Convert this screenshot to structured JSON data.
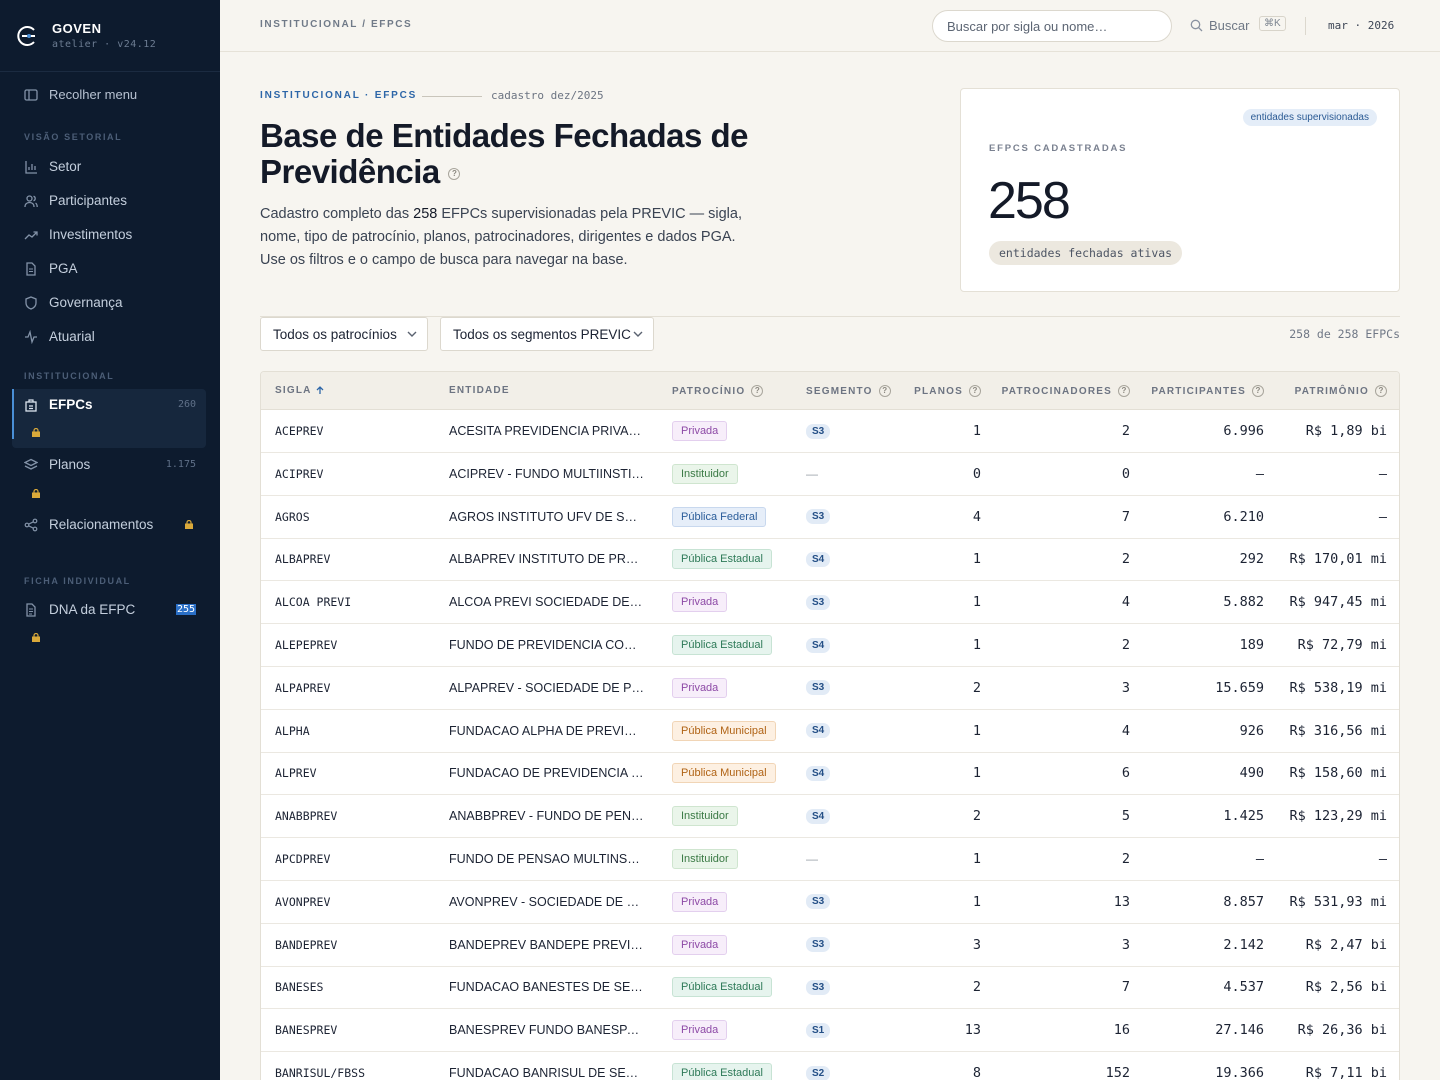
{
  "brand": {
    "name": "GOVEN",
    "version": "atelier · v24.12"
  },
  "sidebar": {
    "collapse_label": "Recolher menu",
    "section_setorial": "VISÃO SETORIAL",
    "setorial_items": [
      {
        "label": "Setor",
        "icon": "bar-chart-icon"
      },
      {
        "label": "Participantes",
        "icon": "users-icon"
      },
      {
        "label": "Investimentos",
        "icon": "trending-up-icon"
      },
      {
        "label": "PGA",
        "icon": "document-icon"
      },
      {
        "label": "Governança",
        "icon": "shield-icon"
      },
      {
        "label": "Atuarial",
        "icon": "pulse-icon"
      }
    ],
    "section_institucional": "INSTITUCIONAL",
    "inst_items": [
      {
        "label": "EFPCs",
        "count": "260",
        "icon": "building-icon"
      },
      {
        "label": "Planos",
        "count": "1.175",
        "icon": "layers-icon"
      },
      {
        "label": "Relacionamentos",
        "icon": "share-icon"
      }
    ],
    "section_ficha": "FICHA INDIVIDUAL",
    "ficha_items": [
      {
        "label": "DNA da EFPC",
        "count": "255",
        "icon": "file-icon"
      }
    ]
  },
  "topbar": {
    "breadcrumb": "INSTITUCIONAL / EFPCS",
    "search_placeholder": "Buscar por sigla ou nome…",
    "search_label": "Buscar",
    "shortcut": "⌘K",
    "period": "mar · 2026"
  },
  "hero": {
    "eyebrow": "INSTITUCIONAL · EFPCS",
    "cadastro": "cadastro dez/2025",
    "title": "Base de Entidades Fechadas de Previdência",
    "desc_pre": "Cadastro completo das ",
    "desc_num": "258",
    "desc_post": " EFPCs supervisionadas pela PREVIC — sigla, nome, tipo de patrocínio, planos, patrocinadores, dirigentes e dados PGA. Use os filtros e o campo de busca para navegar na base."
  },
  "kpi": {
    "tag": "entidades supervisionadas",
    "label": "EFPCS CADASTRADAS",
    "value": "258",
    "pill": "entidades fechadas ativas"
  },
  "filters": {
    "patrocinio": "Todos os patrocínios",
    "segmento": "Todos os segmentos PREVIC",
    "count": "258 de 258 EFPCs"
  },
  "table": {
    "headers": {
      "sigla": "SIGLA",
      "entidade": "ENTIDADE",
      "patrocinio": "PATROCÍNIO",
      "segmento": "SEGMENTO",
      "planos": "PLANOS",
      "patrocinadores": "PATROCINADORES",
      "participantes": "PARTICIPANTES",
      "patrimonio": "PATRIMÔNIO"
    },
    "rows": [
      {
        "sigla": "ACEPREV",
        "entidade": "ACESITA PREVIDENCIA PRIVADA",
        "patrocinio": "Privada",
        "pcls": "privada",
        "segmento": "S3",
        "planos": "1",
        "patrocinadores": "2",
        "participantes": "6.996",
        "patrimonio": "R$ 1,89 bi"
      },
      {
        "sigla": "ACIPREV",
        "entidade": "ACIPREV - FUNDO MULTIINSTITUIDOR",
        "patrocinio": "Instituidor",
        "pcls": "instituidor",
        "segmento": "—",
        "planos": "0",
        "patrocinadores": "0",
        "participantes": "—",
        "patrimonio": "—"
      },
      {
        "sigla": "AGROS",
        "entidade": "AGROS INSTITUTO UFV DE SEGURIDADE SOCIAL",
        "patrocinio": "Pública Federal",
        "pcls": "federal",
        "segmento": "S3",
        "planos": "4",
        "patrocinadores": "7",
        "participantes": "6.210",
        "patrimonio": "—"
      },
      {
        "sigla": "ALBAPREV",
        "entidade": "ALBAPREV INSTITUTO DE PREVIDENCIA",
        "patrocinio": "Pública Estadual",
        "pcls": "estadual",
        "segmento": "S4",
        "planos": "1",
        "patrocinadores": "2",
        "participantes": "292",
        "patrimonio": "R$ 170,01 mi"
      },
      {
        "sigla": "ALCOA PREVI",
        "entidade": "ALCOA PREVI SOCIEDADE DE PREVIDENCIA",
        "patrocinio": "Privada",
        "pcls": "privada",
        "segmento": "S3",
        "planos": "1",
        "patrocinadores": "4",
        "participantes": "5.882",
        "patrimonio": "R$ 947,45 mi"
      },
      {
        "sigla": "ALEPEPREV",
        "entidade": "FUNDO DE PREVIDENCIA COMPLEMENTAR",
        "patrocinio": "Pública Estadual",
        "pcls": "estadual",
        "segmento": "S4",
        "planos": "1",
        "patrocinadores": "2",
        "participantes": "189",
        "patrimonio": "R$ 72,79 mi"
      },
      {
        "sigla": "ALPAPREV",
        "entidade": "ALPAPREV - SOCIEDADE DE PREVIDENCIA",
        "patrocinio": "Privada",
        "pcls": "privada",
        "segmento": "S3",
        "planos": "2",
        "patrocinadores": "3",
        "participantes": "15.659",
        "patrimonio": "R$ 538,19 mi"
      },
      {
        "sigla": "ALPHA",
        "entidade": "FUNDACAO ALPHA DE PREVIDENCIA",
        "patrocinio": "Pública Municipal",
        "pcls": "municipal",
        "segmento": "S4",
        "planos": "1",
        "patrocinadores": "4",
        "participantes": "926",
        "patrimonio": "R$ 316,56 mi"
      },
      {
        "sigla": "ALPREV",
        "entidade": "FUNDACAO  DE PREVIDENCIA COMPLEMENTAR",
        "patrocinio": "Pública Municipal",
        "pcls": "municipal",
        "segmento": "S4",
        "planos": "1",
        "patrocinadores": "6",
        "participantes": "490",
        "patrimonio": "R$ 158,60 mi"
      },
      {
        "sigla": "ANABBPREV",
        "entidade": "ANABBPREV - FUNDO DE PENSAO",
        "patrocinio": "Instituidor",
        "pcls": "instituidor",
        "segmento": "S4",
        "planos": "2",
        "patrocinadores": "5",
        "participantes": "1.425",
        "patrimonio": "R$ 123,29 mi"
      },
      {
        "sigla": "APCDPREV",
        "entidade": "FUNDO DE PENSAO MULTINSTITUIDOR",
        "patrocinio": "Instituidor",
        "pcls": "instituidor",
        "segmento": "—",
        "planos": "1",
        "patrocinadores": "2",
        "participantes": "—",
        "patrimonio": "—"
      },
      {
        "sigla": "AVONPREV",
        "entidade": "AVONPREV - SOCIEDADE DE PREVIDENCIA",
        "patrocinio": "Privada",
        "pcls": "privada",
        "segmento": "S3",
        "planos": "1",
        "patrocinadores": "13",
        "participantes": "8.857",
        "patrimonio": "R$ 531,93 mi"
      },
      {
        "sigla": "BANDEPREV",
        "entidade": "BANDEPREV BANDEPE PREVIDENCIA SOCIAL",
        "patrocinio": "Privada",
        "pcls": "privada",
        "segmento": "S3",
        "planos": "3",
        "patrocinadores": "3",
        "participantes": "2.142",
        "patrimonio": "R$ 2,47 bi"
      },
      {
        "sigla": "BANESES",
        "entidade": "FUNDACAO BANESTES DE SEGURIDADE SOCIAL",
        "patrocinio": "Pública Estadual",
        "pcls": "estadual",
        "segmento": "S3",
        "planos": "2",
        "patrocinadores": "7",
        "participantes": "4.537",
        "patrimonio": "R$ 2,56 bi"
      },
      {
        "sigla": "BANESPREV",
        "entidade": "BANESPREV FUNDO BANESPA DE SEGURIDADE",
        "patrocinio": "Privada",
        "pcls": "privada",
        "segmento": "S1",
        "planos": "13",
        "patrocinadores": "16",
        "participantes": "27.146",
        "patrimonio": "R$ 26,36 bi"
      },
      {
        "sigla": "BANRISUL/FBSS",
        "entidade": "FUNDACAO BANRISUL DE SEGURIDADE SOCIAL",
        "patrocinio": "Pública Estadual",
        "pcls": "estadual",
        "segmento": "S2",
        "planos": "8",
        "patrocinadores": "152",
        "participantes": "19.366",
        "patrimonio": "R$ 7,11 bi"
      }
    ]
  }
}
